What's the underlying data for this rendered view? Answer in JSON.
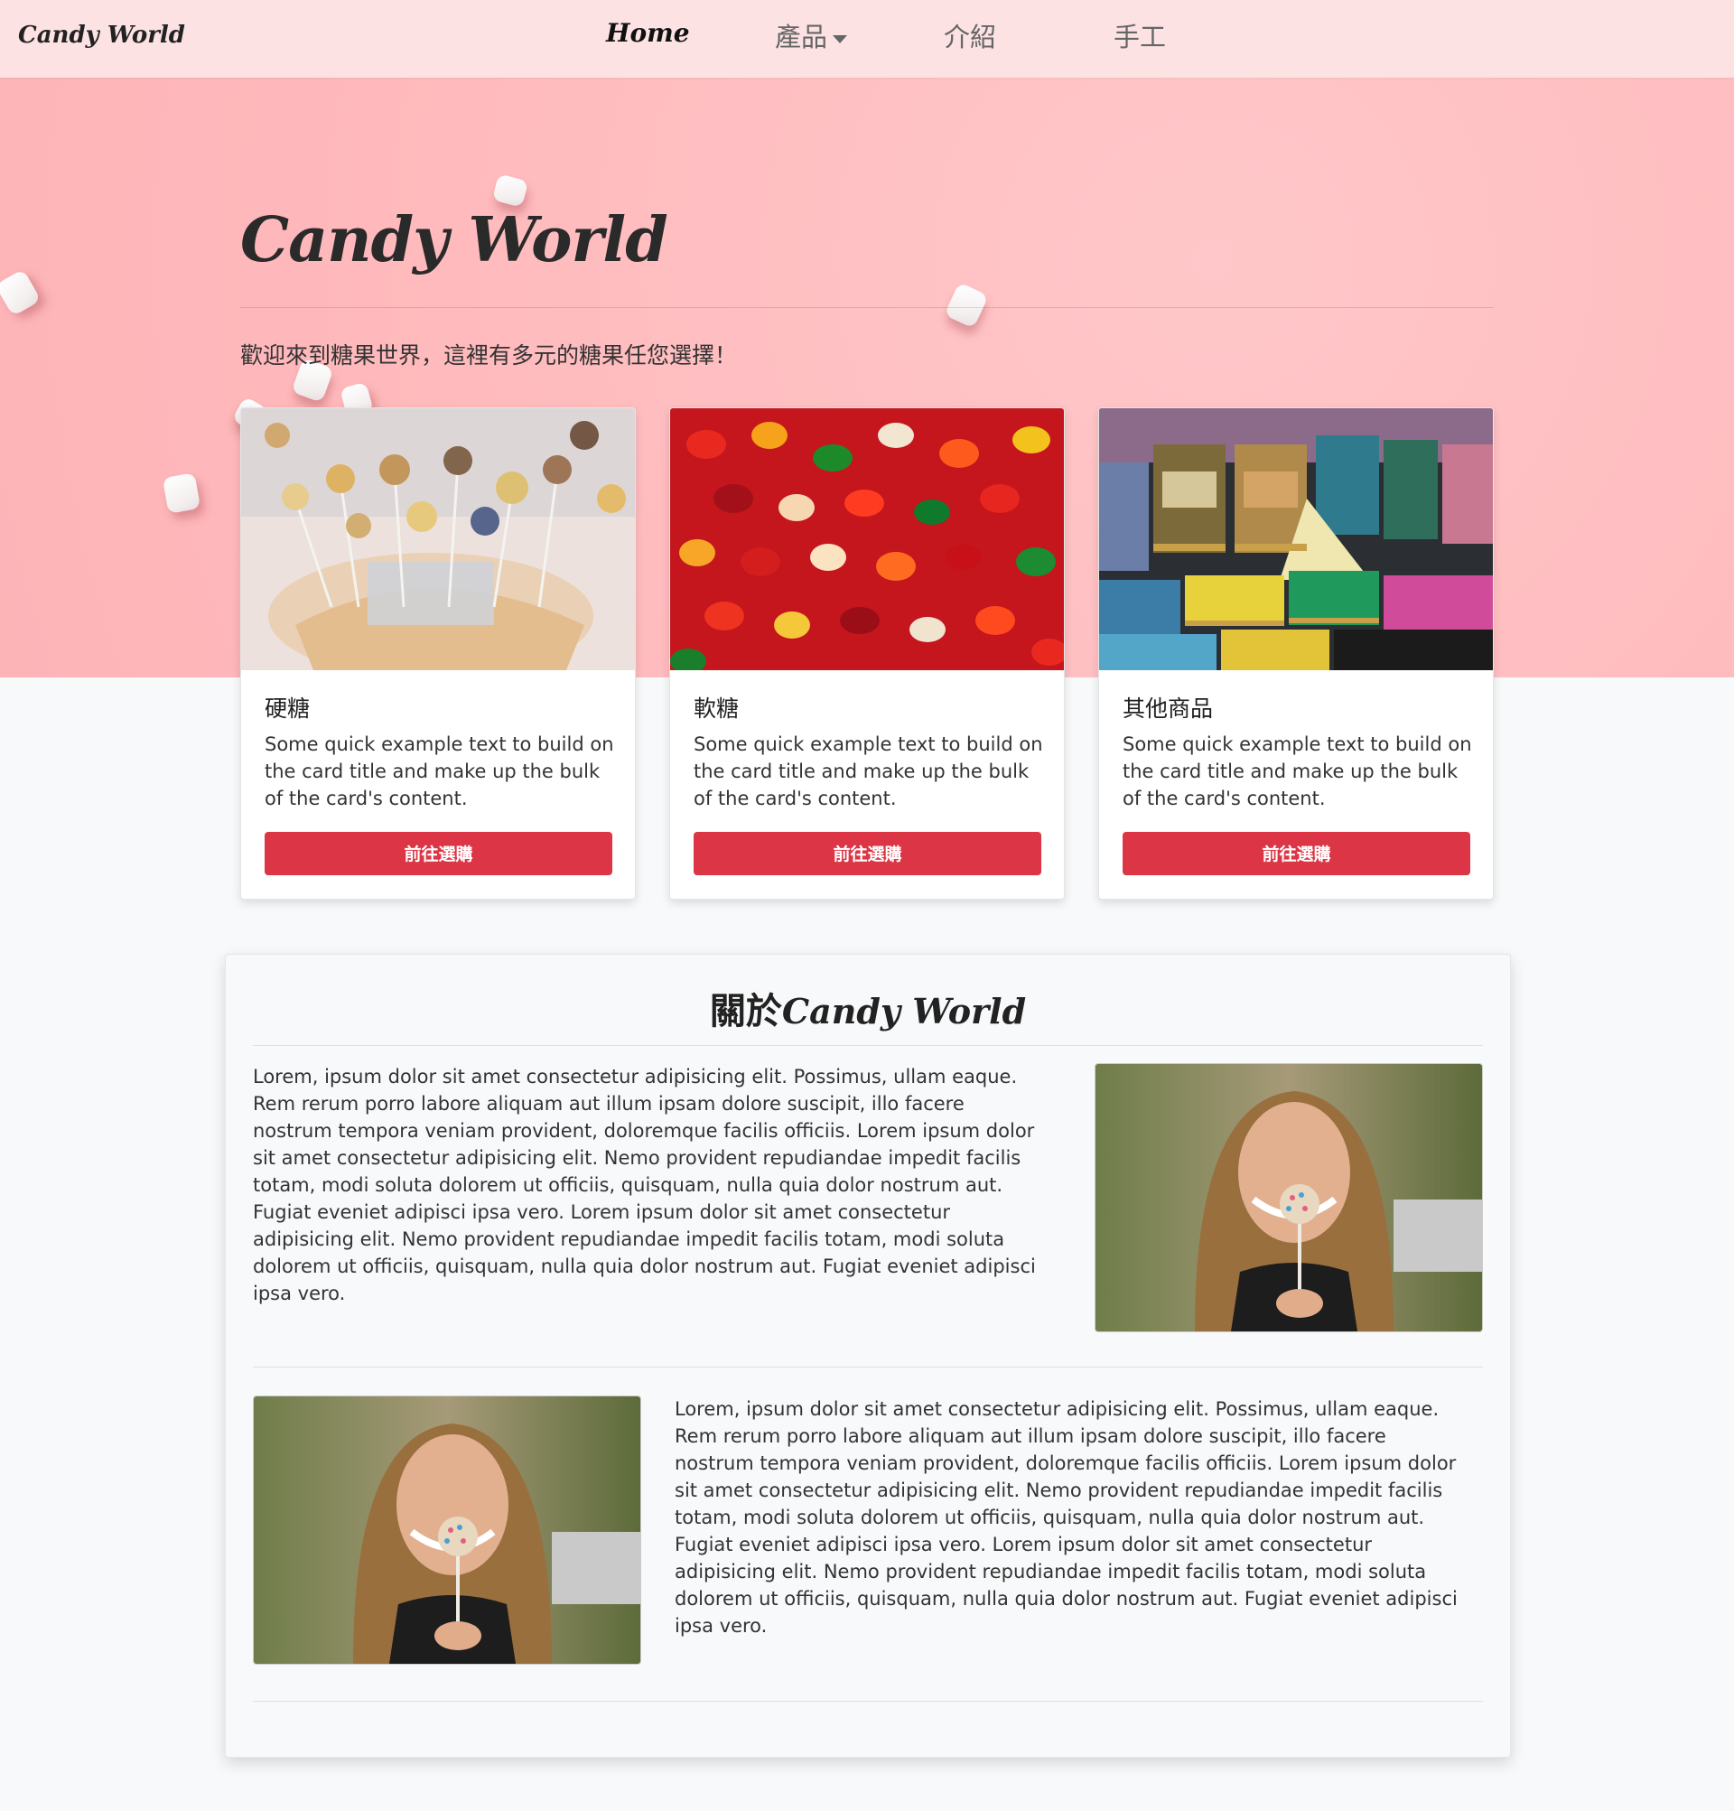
{
  "navbar": {
    "brand": "Candy World",
    "items": [
      {
        "label": "Home"
      },
      {
        "label": "產品"
      },
      {
        "label": "介紹"
      },
      {
        "label": "手工"
      }
    ]
  },
  "hero": {
    "title": "Candy World",
    "subtitle": "歡迎來到糖果世界，這裡有多元的糖果任您選擇！"
  },
  "cards": [
    {
      "title": "硬糖",
      "text": "Some quick example text to build on the card title and make up the bulk of the card's content.",
      "button": "前往選購",
      "image": "lollipops-in-basket-photo"
    },
    {
      "title": "軟糖",
      "text": "Some quick example text to build on the card title and make up the bulk of the card's content.",
      "button": "前往選購",
      "image": "gummy-bears-photo"
    },
    {
      "title": "其他商品",
      "text": "Some quick example text to build on the card title and make up the bulk of the card's content.",
      "button": "前往選購",
      "image": "candy-tins-photo"
    }
  ],
  "about": {
    "title_prefix": "關於",
    "title_brand": "Candy World",
    "paragraph1": "Lorem, ipsum dolor sit amet consectetur adipisicing elit. Possimus, ullam eaque. Rem rerum porro labore aliquam aut illum ipsam dolore suscipit, illo facere nostrum tempora veniam provident, doloremque facilis officiis. Lorem ipsum dolor sit amet consectetur adipisicing elit. Nemo provident repudiandae impedit facilis totam, modi soluta dolorem ut officiis, quisquam, nulla quia dolor nostrum aut. Fugiat eveniet adipisci ipsa vero. Lorem ipsum dolor sit amet consectetur adipisicing elit. Nemo provident repudiandae impedit facilis totam, modi soluta dolorem ut officiis, quisquam, nulla quia dolor nostrum aut. Fugiat eveniet adipisci ipsa vero.",
    "paragraph2": "Lorem, ipsum dolor sit amet consectetur adipisicing elit. Possimus, ullam eaque. Rem rerum porro labore aliquam aut illum ipsam dolore suscipit, illo facere nostrum tempora veniam provident, doloremque facilis officiis. Lorem ipsum dolor sit amet consectetur adipisicing elit. Nemo provident repudiandae impedit facilis totam, modi soluta dolorem ut officiis, quisquam, nulla quia dolor nostrum aut. Fugiat eveniet adipisci ipsa vero. Lorem ipsum dolor sit amet consectetur adipisicing elit. Nemo provident repudiandae impedit facilis totam, modi soluta dolorem ut officiis, quisquam, nulla quia dolor nostrum aut. Fugiat eveniet adipisci ipsa vero.",
    "photo": "woman-holding-cake-pop-photo"
  },
  "colors": {
    "navbar_bg": "#fde2e4",
    "hero_bg": "#ffbcbf",
    "button": "#dc3545",
    "page_bg": "#f8f9fa"
  }
}
